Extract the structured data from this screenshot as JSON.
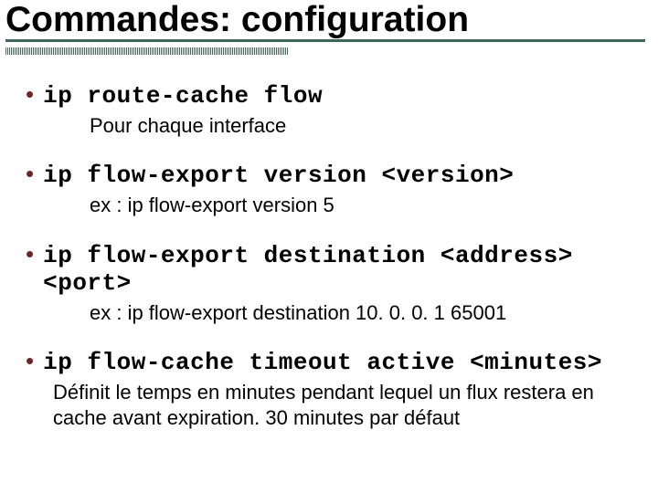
{
  "title": "Commandes: configuration",
  "items": [
    {
      "cmd": "ip route-cache flow",
      "desc": "Pour chaque interface"
    },
    {
      "cmd": "ip flow-export version <version>",
      "desc": "ex :  ip flow-export version 5"
    },
    {
      "cmd": "ip flow-export destination <address> <port>",
      "desc": "ex :  ip flow-export destination 10. 0. 0. 1 65001"
    },
    {
      "cmd": "ip flow-cache timeout active <minutes>",
      "desc": "Définit le temps en minutes pendant lequel un flux restera en cache avant expiration. 30 minutes par défaut"
    }
  ]
}
